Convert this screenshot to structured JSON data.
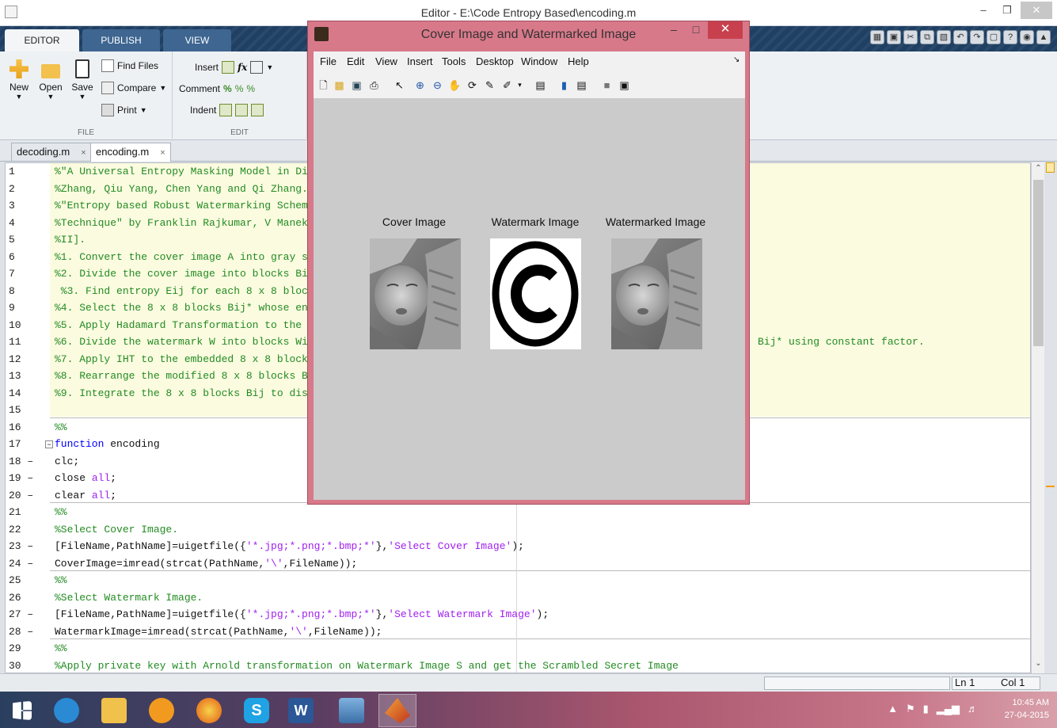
{
  "window": {
    "title": "Editor - E:\\Code Entropy Based\\encoding.m"
  },
  "ribbon_tabs": [
    "EDITOR",
    "PUBLISH",
    "VIEW"
  ],
  "ribbon": {
    "file": {
      "label": "FILE",
      "new": "New",
      "open": "Open",
      "save": "Save",
      "find_files": "Find Files",
      "compare": "Compare",
      "print": "Print"
    },
    "edit": {
      "label": "EDIT",
      "insert": "Insert",
      "comment": "Comment",
      "indent": "Indent"
    }
  },
  "file_tabs": [
    {
      "name": "decoding.m",
      "close": "×"
    },
    {
      "name": "encoding.m",
      "close": "×"
    }
  ],
  "editor_lines": [
    {
      "n": "1",
      "t": "%\"A Universal Entropy Masking Model in Di"
    },
    {
      "n": "2",
      "t": "%Zhang, Qiu Yang, Chen Yang and Qi Zhang."
    },
    {
      "n": "3",
      "t": "%\"Entropy based Robust Watermarking Schem"
    },
    {
      "n": "4",
      "t": "%Technique\" by Franklin Rajkumar, V Manek"
    },
    {
      "n": "5",
      "t": "%II]."
    },
    {
      "n": "6",
      "t": "%1. Convert the cover image A into gray s"
    },
    {
      "n": "7",
      "t": "%2. Divide the cover image into blocks Bi"
    },
    {
      "n": "8",
      "t": " %3. Find entropy Eij for each 8 x 8 bloc"
    },
    {
      "n": "9",
      "t": "%4. Select the 8 x 8 blocks Bij* whose en"
    },
    {
      "n": "10",
      "t": "%5. Apply Hadamard Transformation to the "
    },
    {
      "n": "11",
      "t": "%6. Divide the watermark W into blocks Wi",
      "tail": "Bij* using constant factor."
    },
    {
      "n": "12",
      "t": "%7. Apply IHT to the embedded 8 x 8 block"
    },
    {
      "n": "13",
      "t": "%8. Rearrange the modified 8 x 8 blocks B"
    },
    {
      "n": "14",
      "t": "%9. Integrate the 8 x 8 blocks Bij to dis"
    },
    {
      "n": "15",
      "t": ""
    },
    {
      "n": "16",
      "t": "%%"
    },
    {
      "n": "17",
      "kw": "function",
      "rest": " encoding"
    },
    {
      "n": "18 –",
      "plain": "clc;"
    },
    {
      "n": "19 –",
      "plain": "close ",
      "strpart": "all",
      "end": ";"
    },
    {
      "n": "20 –",
      "plain": "clear ",
      "strpart": "all",
      "end": ";"
    },
    {
      "n": "21",
      "t": "%%"
    },
    {
      "n": "22",
      "t": "%Select Cover Image."
    },
    {
      "n": "23 –",
      "plain": "[FileName,PathName]=uigetfile({",
      "strpart": "'*.jpg;*.png;*.bmp;*'",
      "mid": "},",
      "str2": "'Select Cover Image'",
      "end": ");"
    },
    {
      "n": "24 –",
      "plain": "CoverImage=imread(strcat(PathName,",
      "strpart": "'\\'",
      "end": ",FileName));"
    },
    {
      "n": "25",
      "t": "%%"
    },
    {
      "n": "26",
      "t": "%Select Watermark Image."
    },
    {
      "n": "27 –",
      "plain": "[FileName,PathName]=uigetfile({",
      "strpart": "'*.jpg;*.png;*.bmp;*'",
      "mid": "},",
      "str2": "'Select Watermark Image'",
      "end": ");"
    },
    {
      "n": "28 –",
      "plain": "WatermarkImage=imread(strcat(PathName,",
      "strpart": "'\\'",
      "end": ",FileName));"
    },
    {
      "n": "29",
      "t": "%%"
    },
    {
      "n": "30",
      "t": "%Apply private key with Arnold transformation on Watermark Image S and get the Scrambled Secret Image"
    }
  ],
  "status": {
    "ln": "Ln  1",
    "col": "Col  1"
  },
  "figure": {
    "title": "Cover Image and Watermarked Image",
    "menu": [
      "File",
      "Edit",
      "View",
      "Insert",
      "Tools",
      "Desktop",
      "Window",
      "Help"
    ],
    "panels": [
      "Cover Image",
      "Watermark Image",
      "Watermarked Image"
    ]
  },
  "taskbar": {
    "time": "10:45 AM",
    "date": "27-04-2015"
  },
  "colors": {
    "comment": "#228b22",
    "keyword": "#0000ff",
    "string": "#a020f0",
    "ribbon_dark": "#1f3f63",
    "figure_frame": "#d8798a"
  }
}
